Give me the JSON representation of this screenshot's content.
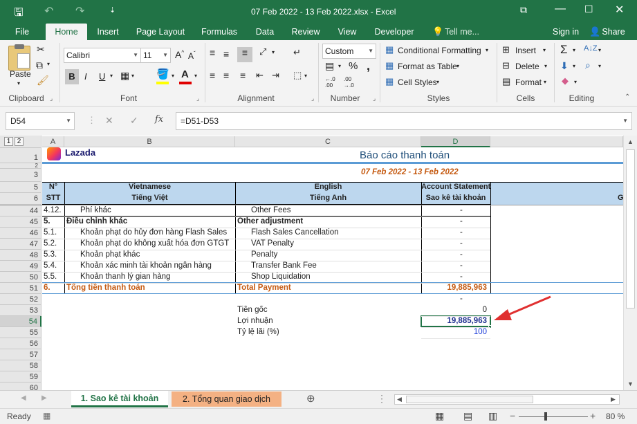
{
  "window": {
    "title": "07 Feb 2022 - 13 Feb 2022.xlsx - Excel"
  },
  "ribbon_tabs": [
    "File",
    "Home",
    "Insert",
    "Page Layout",
    "Formulas",
    "Data",
    "Review",
    "View",
    "Developer",
    "Tell me...",
    "Sign in",
    "Share"
  ],
  "font": {
    "name": "Calibri",
    "size": "11",
    "bold": "B",
    "italic": "I",
    "underline": "U",
    "grow": "A",
    "shrink": "A"
  },
  "number_format": "Custom",
  "clipboard": {
    "paste": "Paste",
    "label": "Clipboard"
  },
  "groups": {
    "font": "Font",
    "alignment": "Alignment",
    "number": "Number",
    "styles": "Styles",
    "cells": "Cells",
    "editing": "Editing"
  },
  "styles": {
    "conditional": "Conditional Formatting",
    "table": "Format as Table",
    "cell_styles": "Cell Styles"
  },
  "cells": {
    "insert": "Insert",
    "delete": "Delete",
    "format": "Format"
  },
  "number_symbols": {
    "percent": "%",
    "comma": ",",
    "inc": ".0\n.00",
    "dec": ".00\n→.0"
  },
  "formula_bar": {
    "name_box": "D54",
    "cancel": "✕",
    "enter": "✓",
    "fx": "fx",
    "formula": "=D51-D53"
  },
  "outline_levels": [
    "1",
    "2"
  ],
  "columns": [
    "A",
    "B",
    "C",
    "D"
  ],
  "sheet": {
    "logo_text": "Lazada",
    "report_title": "Báo cáo thanh toán",
    "date_range": "07 Feb 2022 - 13 Feb 2022",
    "hdr_a1": "N°",
    "hdr_a2": "STT",
    "hdr_b1": "Vietnamese",
    "hdr_b2": "Tiếng Việt",
    "hdr_c1": "English",
    "hdr_c2": "Tiếng Anh",
    "hdr_d1": "Account Statement",
    "hdr_d2": "Sao kê tài khoản",
    "hdr_e": "G",
    "rows": [
      {
        "num": "44",
        "a": "4.12.",
        "b": "Phí khác",
        "c": "Other Fees",
        "d": "-"
      },
      {
        "num": "45",
        "a": "5.",
        "b": "Điều chỉnh khác",
        "c": "Other adjustment",
        "d": "-"
      },
      {
        "num": "46",
        "a": "5.1.",
        "b": "Khoản phạt do hủy đơn hàng Flash Sales",
        "c": "Flash Sales Cancellation",
        "d": "-"
      },
      {
        "num": "47",
        "a": "5.2.",
        "b": "Khoản phạt do không xuất hóa đơn GTGT",
        "c": "VAT Penalty",
        "d": "-"
      },
      {
        "num": "48",
        "a": "5.3.",
        "b": "Khoản phạt khác",
        "c": "Penalty",
        "d": "-"
      },
      {
        "num": "49",
        "a": "5.4.",
        "b": "Khoản xác minh tài khoản ngân hàng",
        "c": "Transfer Bank Fee",
        "d": "-"
      },
      {
        "num": "50",
        "a": "5.5.",
        "b": "Khoản thanh lý gian hàng",
        "c": "Shop Liquidation",
        "d": "-"
      },
      {
        "num": "51",
        "a": "6.",
        "b": "Tổng tiền thanh toán",
        "c": "Total Payment",
        "d": "19,885,963"
      },
      {
        "num": "52",
        "a": "",
        "b": "",
        "c": "",
        "d": "-"
      },
      {
        "num": "53",
        "a": "",
        "b": "",
        "c": "Tiền gốc",
        "d": "0"
      },
      {
        "num": "54",
        "a": "",
        "b": "",
        "c": "Lợi nhuận",
        "d": "19,885,963"
      },
      {
        "num": "55",
        "a": "",
        "b": "",
        "c": "Tỷ lệ lãi (%)",
        "d": "100"
      },
      {
        "num": "56",
        "a": "",
        "b": "",
        "c": "",
        "d": ""
      },
      {
        "num": "57",
        "a": "",
        "b": "",
        "c": "",
        "d": ""
      },
      {
        "num": "58",
        "a": "",
        "b": "",
        "c": "",
        "d": ""
      },
      {
        "num": "59",
        "a": "",
        "b": "",
        "c": "",
        "d": ""
      },
      {
        "num": "60",
        "a": "",
        "b": "",
        "c": "",
        "d": ""
      }
    ],
    "top_rows": [
      "1",
      "2",
      "3",
      "5",
      "6"
    ]
  },
  "sheet_tabs": [
    "1. Sao kê tài khoản",
    "2. Tổng quan giao dịch"
  ],
  "status": {
    "ready": "Ready",
    "zoom": "80 %",
    "zoom_minus": "−",
    "zoom_plus": "+"
  },
  "colors": {
    "excel_green": "#217346",
    "header_blue": "#bdd7ee",
    "total_orange": "#c55a11",
    "tab2_bg": "#f4b183",
    "arrow_red": "#e03030"
  }
}
